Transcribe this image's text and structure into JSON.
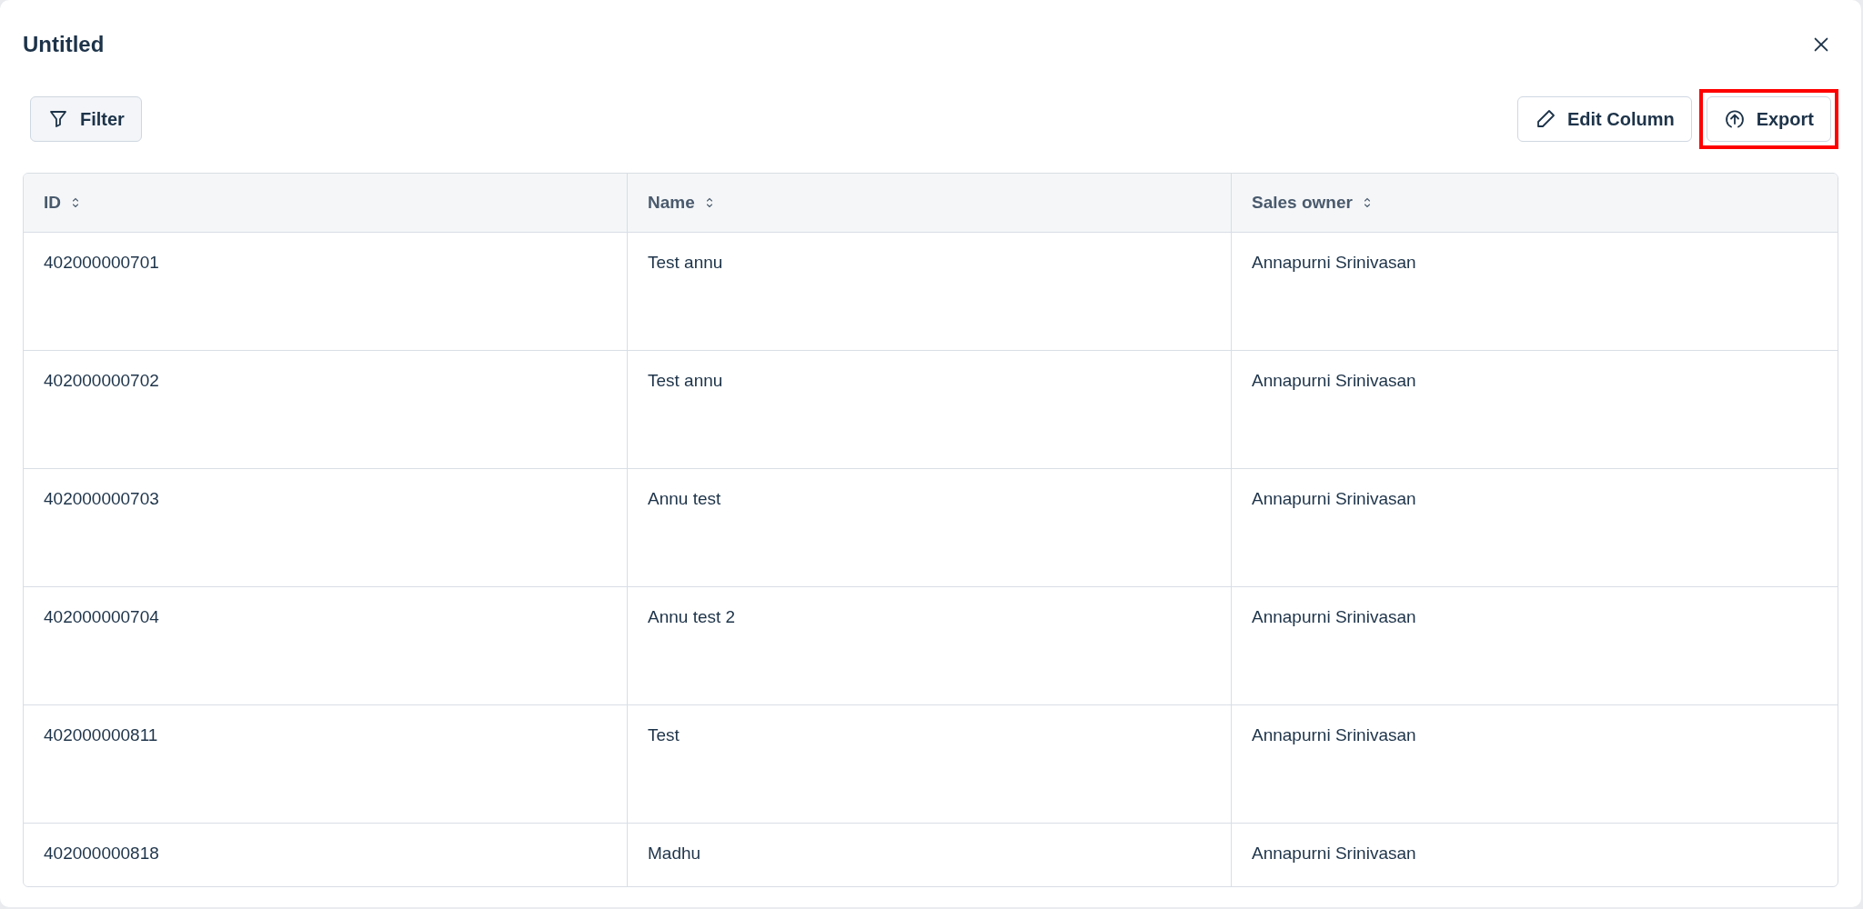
{
  "dialog": {
    "title": "Untitled"
  },
  "toolbar": {
    "left": [
      {
        "kind": "filter",
        "label": "Filter",
        "highlighted": false
      }
    ],
    "right": [
      {
        "kind": "edit",
        "label": "Edit Column",
        "highlighted": false
      },
      {
        "kind": "export",
        "label": "Export",
        "highlighted": true
      }
    ]
  },
  "table": {
    "columns": [
      {
        "label": "ID"
      },
      {
        "label": "Name"
      },
      {
        "label": "Sales owner"
      }
    ],
    "rows": [
      [
        "402000000701",
        "Test annu",
        "Annapurni Srinivasan"
      ],
      [
        "402000000702",
        "Test annu",
        "Annapurni Srinivasan"
      ],
      [
        "402000000703",
        "Annu test",
        "Annapurni Srinivasan"
      ],
      [
        "402000000704",
        "Annu test 2",
        "Annapurni Srinivasan"
      ],
      [
        "402000000811",
        "Test",
        "Annapurni Srinivasan"
      ],
      [
        "402000000818",
        "Madhu",
        "Annapurni Srinivasan"
      ]
    ]
  }
}
